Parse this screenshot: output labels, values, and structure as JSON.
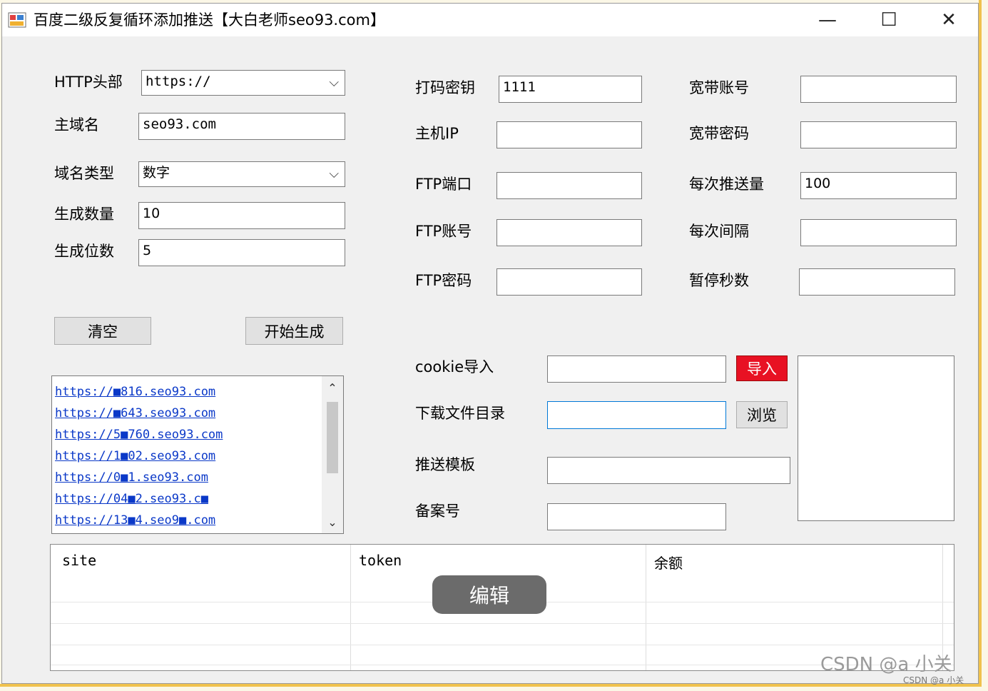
{
  "window": {
    "title": "百度二级反复循环添加推送【大白老师seo93.com】",
    "minimize": "—",
    "maximize": "☐",
    "close": "✕"
  },
  "left_form": {
    "http_head_label": "HTTP头部",
    "http_head_value": "https://",
    "main_domain_label": "主域名",
    "main_domain_value": "seo93.com",
    "domain_type_label": "域名类型",
    "domain_type_value": "数字",
    "gen_count_label": "生成数量",
    "gen_count_value": "10",
    "gen_digits_label": "生成位数",
    "gen_digits_value": "5",
    "clear_button": "清空",
    "start_button": "开始生成"
  },
  "url_list": [
    "https://■816.seo93.com",
    "https://■643.seo93.com",
    "https://5■760.seo93.com",
    "https://1■02.seo93.com",
    "https://0■1.seo93.com",
    "https://04■2.seo93.c■",
    "https://13■4.seo9■.com"
  ],
  "mid_form": {
    "key_label": "打码密钥",
    "key_value": "1111",
    "host_ip_label": "主机IP",
    "host_ip_value": "",
    "ftp_port_label": "FTP端口",
    "ftp_port_value": "",
    "ftp_account_label": "FTP账号",
    "ftp_account_value": "",
    "ftp_password_label": "FTP密码",
    "ftp_password_value": ""
  },
  "right_form": {
    "broadband_account_label": "宽带账号",
    "broadband_account_value": "",
    "broadband_password_label": "宽带密码",
    "broadband_password_value": "",
    "push_count_label": "每次推送量",
    "push_count_value": "100",
    "interval_label": "每次间隔",
    "interval_value": "",
    "pause_seconds_label": "暂停秒数",
    "pause_seconds_value": ""
  },
  "lower_form": {
    "cookie_label": "cookie导入",
    "cookie_value": "",
    "import_button": "导入",
    "download_dir_label": "下载文件目录",
    "download_dir_value": "",
    "browse_button": "浏览",
    "push_template_label": "推送模板",
    "push_template_value": "",
    "icp_label": "备案号",
    "icp_value": ""
  },
  "grid": {
    "columns": [
      "site",
      "token",
      "余额"
    ]
  },
  "overlay": {
    "edit_label": "编辑",
    "watermark": "CSDN @a  小关",
    "watermark_small": "CSDN @a  小关"
  }
}
